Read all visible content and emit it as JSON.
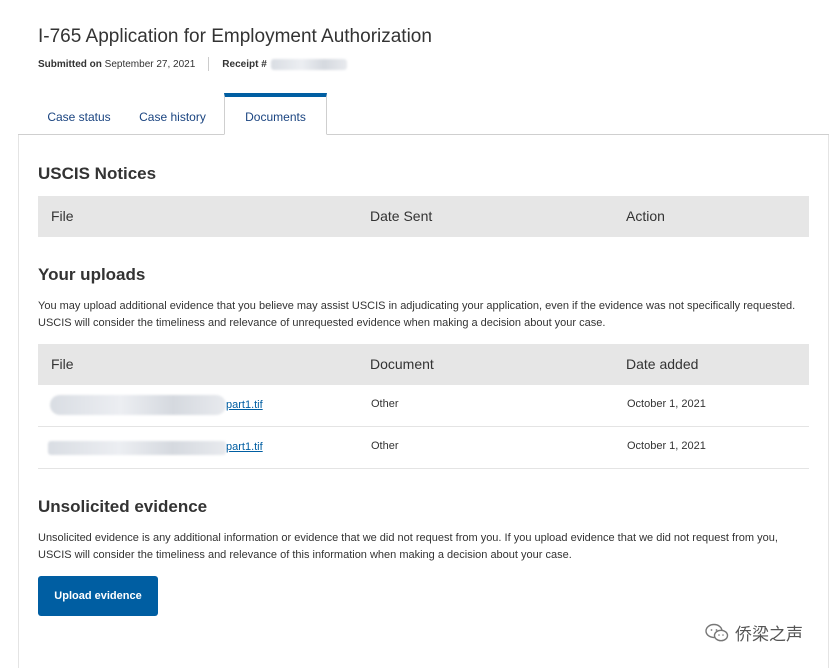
{
  "header": {
    "title": "I-765 Application for Employment Authorization",
    "submitted_label": "Submitted on",
    "submitted_date": "September 27, 2021",
    "receipt_label": "Receipt #"
  },
  "tabs": [
    {
      "label": "Case status"
    },
    {
      "label": "Case history"
    },
    {
      "label": "Documents",
      "active": true
    }
  ],
  "notices": {
    "title": "USCIS Notices",
    "columns": [
      "File",
      "Date Sent",
      "Action"
    ]
  },
  "uploads": {
    "title": "Your uploads",
    "description": "You may upload additional evidence that you believe may assist USCIS in adjudicating your application, even if the evidence was not specifically requested. USCIS will consider the timeliness and relevance of unrequested evidence when making a decision about your case.",
    "columns": [
      "File",
      "Document",
      "Date added"
    ],
    "rows": [
      {
        "file_suffix": "part1.tif",
        "document": "Other",
        "date_added": "October 1, 2021"
      },
      {
        "file_suffix": "part1.tif",
        "document": "Other",
        "date_added": "October 1, 2021"
      }
    ]
  },
  "unsolicited": {
    "title": "Unsolicited evidence",
    "description": "Unsolicited evidence is any additional information or evidence that we did not request from you. If you upload evidence that we did not request from you, USCIS will consider the timeliness and relevance of this information when making a decision about your case.",
    "button_label": "Upload evidence"
  },
  "watermark": {
    "text": "侨梁之声",
    "icon": "wechat-logo-icon"
  },
  "colors": {
    "accent": "#005ea2",
    "table_header_bg": "#e6e6e6"
  }
}
